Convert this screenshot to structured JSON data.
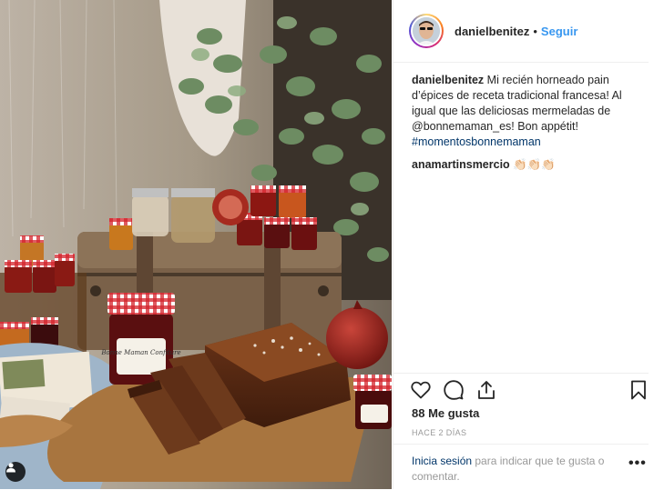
{
  "post": {
    "username": "danielbenitez",
    "separator": "•",
    "follow_label": "Seguir",
    "caption_username": "danielbenitez",
    "caption_text": " Mi recién horneado pain d’épices de receta tradicional francesa! Al igual que las deliciosas mermeladas de @bonnemaman_es! Bon appétit! ",
    "caption_hashtag": "#momentosbonnemaman",
    "comment_username": "anamartinsmercio",
    "comment_text": " 👏🏻👏🏻👏🏻",
    "likes": "88 Me gusta",
    "timestamp": "HACE 2 DÍAS",
    "login_link": "Inicia sesión",
    "login_text": " para indicar que te gusta o comentar.",
    "more_options": "•••"
  },
  "photo": {
    "jar_label_text": "Bonne Maman Confiture",
    "colors": {
      "wall": "#a89c8c",
      "board": "#a8753f",
      "cake": "#5e2e16",
      "gingham": "#c8202a"
    }
  },
  "icons": {
    "like": "heart-icon",
    "comment": "comment-icon",
    "share": "share-icon",
    "save": "bookmark-icon",
    "tagged": "user-tag-icon"
  }
}
